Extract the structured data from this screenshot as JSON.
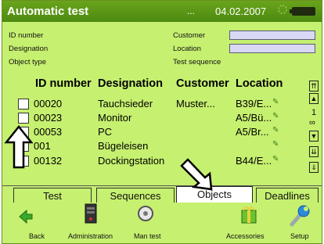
{
  "titlebar": {
    "title": "Automatic test",
    "ellipsis": "...",
    "date": "04.02.2007"
  },
  "filters": {
    "id_label": "ID number",
    "designation_label": "Designation",
    "object_type_label": "Object type",
    "customer_label": "Customer",
    "location_label": "Location",
    "test_sequence_label": "Test sequence",
    "customer_value": "",
    "location_value": ""
  },
  "table": {
    "headers": [
      "ID number",
      "Designation",
      "Customer",
      "Location"
    ],
    "rows": [
      {
        "id": "00020",
        "designation": "Tauchsieder",
        "customer": "Muster...",
        "location": "B39/E..."
      },
      {
        "id": "00023",
        "designation": "Monitor",
        "customer": "",
        "location": "A5/Bü..."
      },
      {
        "id": "00053",
        "designation": "PC",
        "customer": "",
        "location": "A5/Br..."
      },
      {
        "id": "001",
        "designation": "Bügeleisen",
        "customer": "",
        "location": ""
      },
      {
        "id": "00132",
        "designation": "Dockingstation",
        "customer": "",
        "location": "B44/E..."
      }
    ]
  },
  "scroll": {
    "page_label": "1"
  },
  "tabs": [
    "Test",
    "Sequences",
    "Objects",
    "Deadlines"
  ],
  "active_tab": "Objects",
  "toolbar": [
    "Back",
    "Administration",
    "Man test",
    "Accessories",
    "Setup"
  ],
  "colors": {
    "background": "#c6f070",
    "titlebar": "#4c8a10",
    "filter_input": "#d9d9f6"
  }
}
